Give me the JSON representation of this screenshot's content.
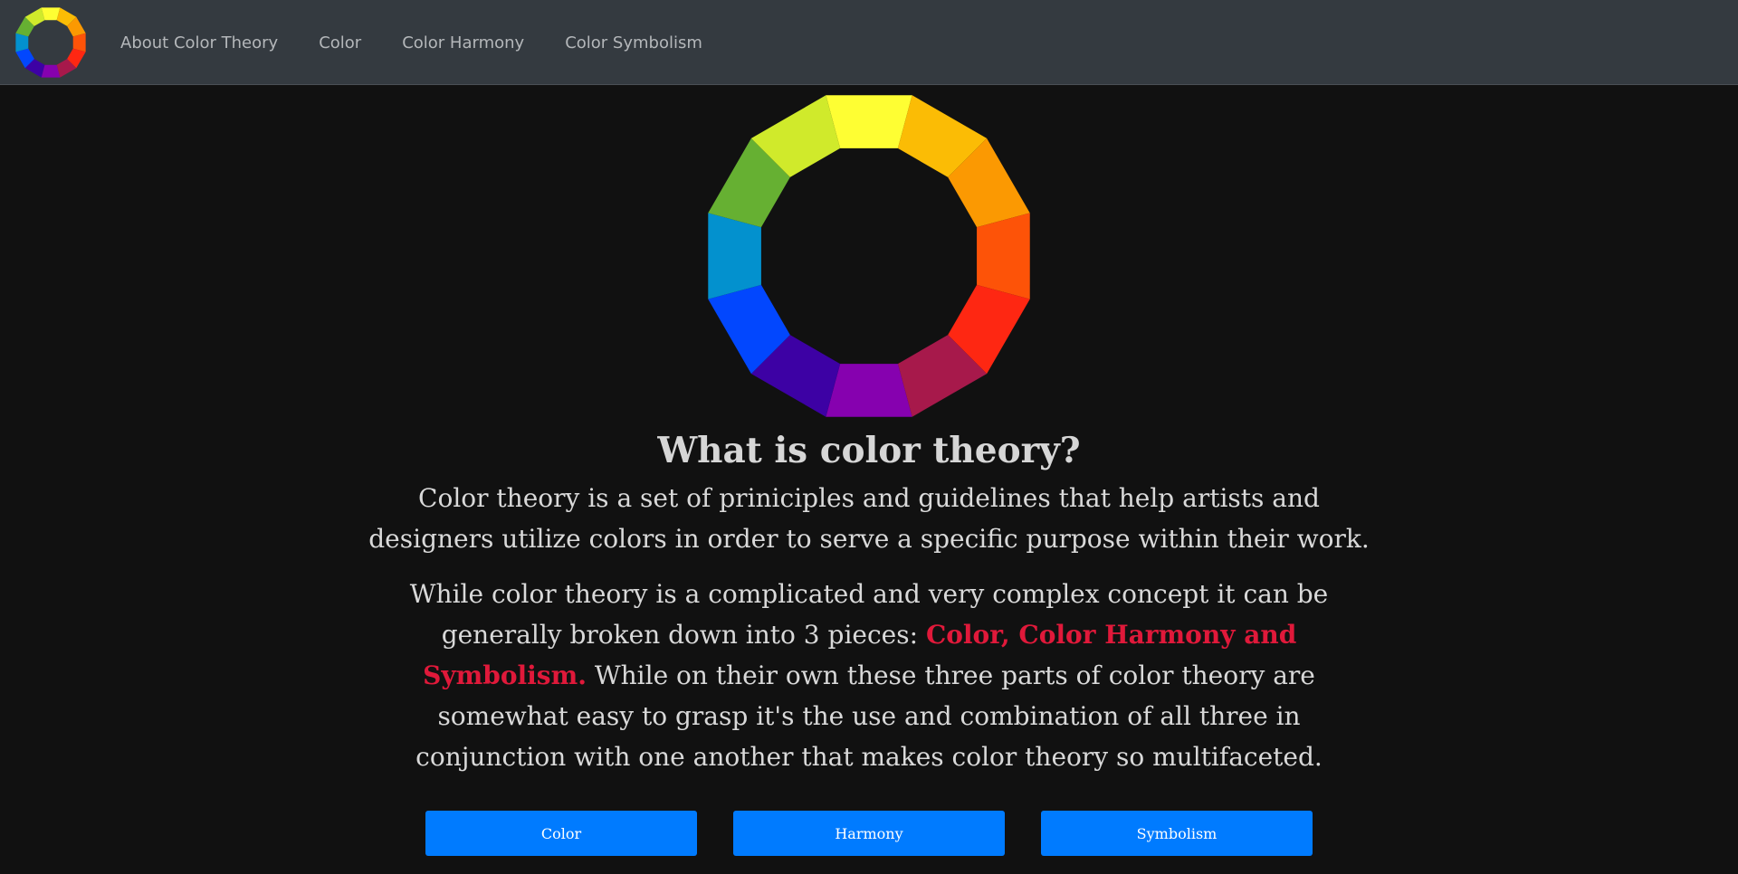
{
  "nav": {
    "logo_icon": "color-wheel-icon",
    "links": [
      "About Color Theory",
      "Color",
      "Color Harmony",
      "Color Symbolism"
    ]
  },
  "wheel": {
    "icon": "color-wheel-icon",
    "colors": [
      "#fefe33",
      "#fbbc05",
      "#fb9902",
      "#fd5308",
      "#fe2712",
      "#a7194b",
      "#8601af",
      "#3d01a4",
      "#0247fe",
      "#0391ce",
      "#66b032",
      "#d0ea2b"
    ]
  },
  "main": {
    "title": "What is color theory?",
    "intro": "Color theory is a set of priniciples and guidelines that help artists and designers utilize colors in order to serve a specific purpose within their work.",
    "detail_before": "While color theory is a complicated and very complex concept it can be generally broken down into 3 pieces: ",
    "detail_highlight": "Color, Color Harmony and Symbolism.",
    "detail_after": " While on their own these three parts of color theory are somewhat easy to grasp it's the use and combination of all three in conjunction with one another that makes color theory so multifaceted."
  },
  "buttons": {
    "color": "Color",
    "harmony": "Harmony",
    "symbolism": "Symbolism"
  },
  "colors": {
    "navbar_bg": "#343a40",
    "page_bg": "#111111",
    "nav_text": "#b4b7ba",
    "highlight": "#e0193a",
    "button_bg": "#007bff"
  }
}
